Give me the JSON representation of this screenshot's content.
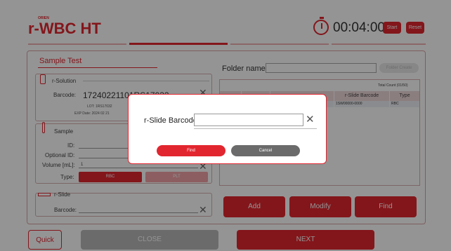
{
  "header": {
    "logo_small": "ORIEN",
    "logo": "r-WBC HT",
    "timer": "00:04:00",
    "start_label": "Start",
    "reset_label": "Reset"
  },
  "sample_test": {
    "title": "Sample Test",
    "rsolution": {
      "title": "r-Solution",
      "barcode_label": "Barcode:",
      "barcode_value": "17240221101RS17032",
      "lot": "LOT: 1RS17032",
      "exp": "EXP Date:  2024 02 21"
    },
    "sample": {
      "title": "Sample",
      "id_label": "ID:",
      "optional_id_label": "Optional ID:",
      "volume_label": "Volume [mL]:",
      "volume_value": "1",
      "type_label": "Type:",
      "type_rbc": "RBC",
      "type_plt": "PLT"
    },
    "rslide": {
      "title": "r-Slide",
      "barcode_label": "Barcode:"
    }
  },
  "folder": {
    "label": "Folder name:",
    "value": "",
    "create_label": "Folder Create"
  },
  "table": {
    "total_count": "Total Count (01/50)",
    "columns": [
      "",
      "",
      "",
      "r-Slide Barcode",
      "Type"
    ],
    "rows": [
      [
        "",
        "",
        "",
        "1SW00000-0000",
        "RBC"
      ]
    ]
  },
  "actions": {
    "add": "Add",
    "modify": "Modify",
    "find": "Find"
  },
  "bottom": {
    "quick": "Quick",
    "close": "CLOSE",
    "next": "NEXT"
  },
  "dialog": {
    "label": "r-Slide Barcode",
    "value": "",
    "find": "Find",
    "cancel": "Cancel"
  },
  "colors": {
    "accent": "#e2262f",
    "cancel": "#6b6b6b"
  }
}
